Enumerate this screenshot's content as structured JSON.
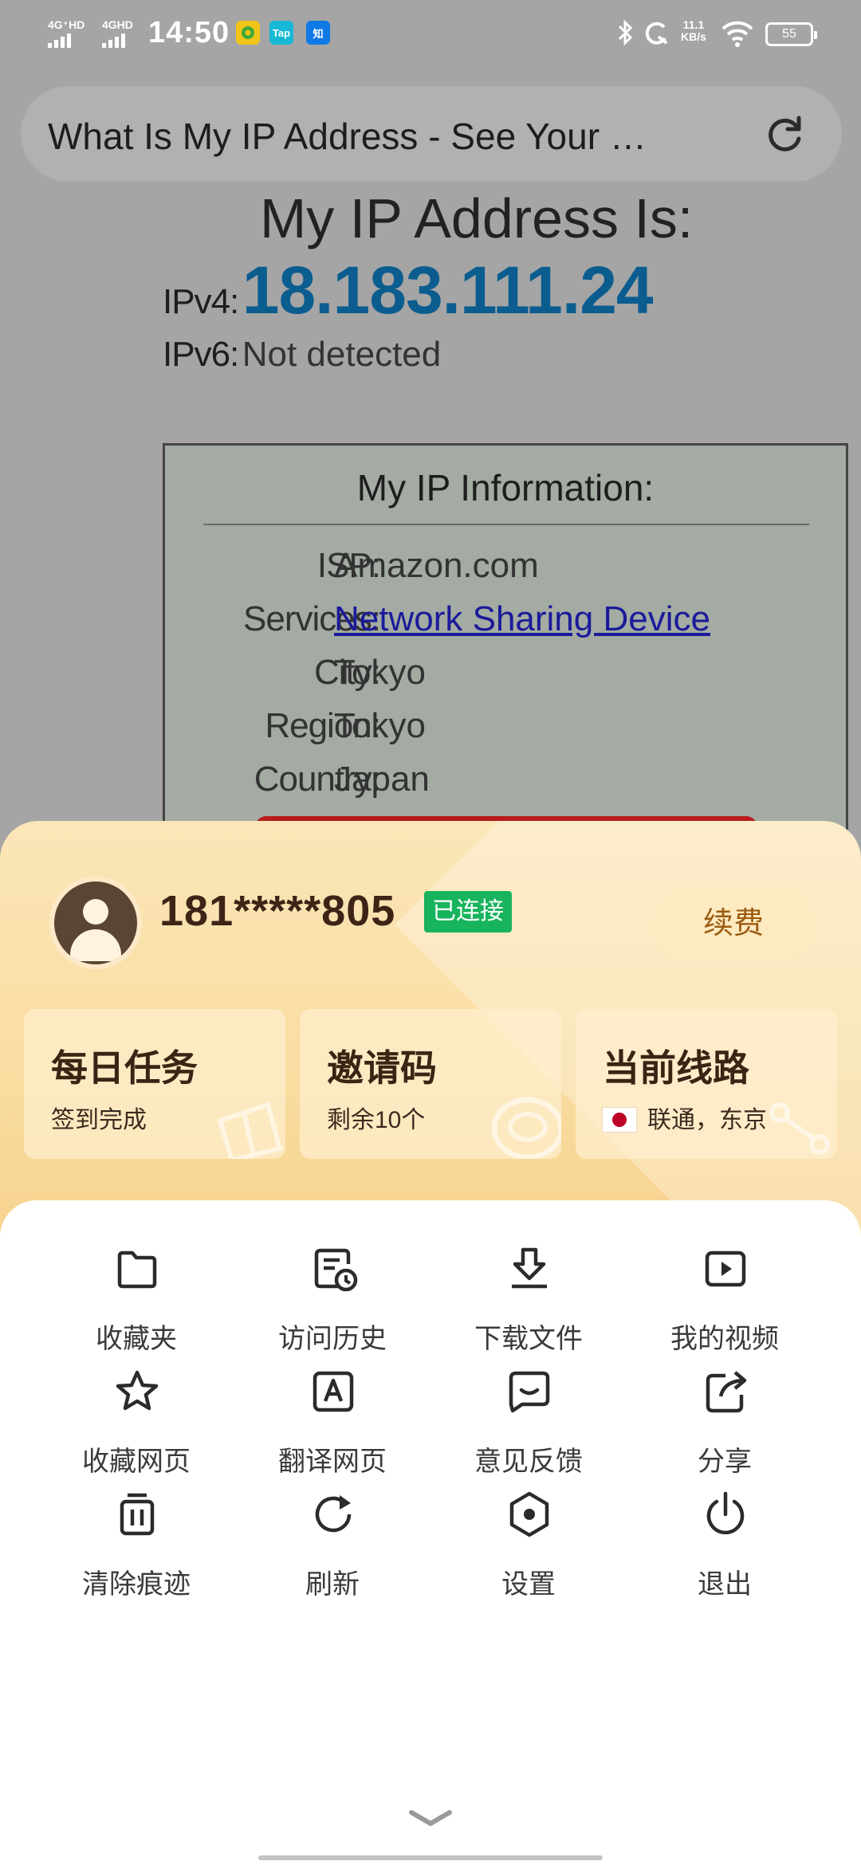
{
  "status_bar": {
    "time": "14:50",
    "signal_1": "4G⁺HD",
    "signal_2": "4GHD",
    "app_tap": "Tap",
    "app_zhi": "知",
    "net_speed_value": "11.1",
    "net_speed_unit": "KB/s",
    "battery": "55",
    "icons": [
      "bluetooth-icon",
      "alarm-icon",
      "wifi-icon",
      "battery-icon"
    ]
  },
  "browser": {
    "page_title": "What Is My IP Address - See Your …",
    "reload_icon": "reload-icon"
  },
  "webpage": {
    "heading": "My IP Address Is:",
    "ipv4_label": "IPv4:",
    "ipv4_value": "18.183.111.24",
    "ipv6_label": "IPv6:",
    "ipv6_value": "Not detected",
    "info_title": "My IP Information:",
    "info_rows": [
      {
        "key": "ISP:",
        "value": "Amazon.com"
      },
      {
        "key": "Services:",
        "value": "Network Sharing Device"
      },
      {
        "key": "City:",
        "value": "Tokyo"
      },
      {
        "key": "Region:",
        "value": "Tokyo"
      },
      {
        "key": "Country:",
        "value": "Japan"
      }
    ]
  },
  "account": {
    "phone": "181*****805",
    "status_badge": "已连接",
    "renew_label": "续费"
  },
  "cards": [
    {
      "title": "每日任务",
      "subtitle": "签到完成"
    },
    {
      "title": "邀请码",
      "subtitle": "剩余10个"
    },
    {
      "title": "当前线路",
      "subtitle": "联通，东京"
    }
  ],
  "menu": [
    {
      "label": "收藏夹",
      "icon": "folder-icon"
    },
    {
      "label": "访问历史",
      "icon": "history-icon"
    },
    {
      "label": "下载文件",
      "icon": "download-icon"
    },
    {
      "label": "我的视频",
      "icon": "video-icon"
    },
    {
      "label": "收藏网页",
      "icon": "star-icon"
    },
    {
      "label": "翻译网页",
      "icon": "translate-icon"
    },
    {
      "label": "意见反馈",
      "icon": "feedback-icon"
    },
    {
      "label": "分享",
      "icon": "share-icon"
    },
    {
      "label": "清除痕迹",
      "icon": "clear-trace-icon"
    },
    {
      "label": "刷新",
      "icon": "refresh-icon"
    },
    {
      "label": "设置",
      "icon": "settings-icon"
    },
    {
      "label": "退出",
      "icon": "power-icon"
    }
  ],
  "colors": {
    "ipv4": "#0b5d8f",
    "badge_green": "#18b45d",
    "sheet_gold": "#f9dca0",
    "renew_text": "#9b5b10"
  }
}
